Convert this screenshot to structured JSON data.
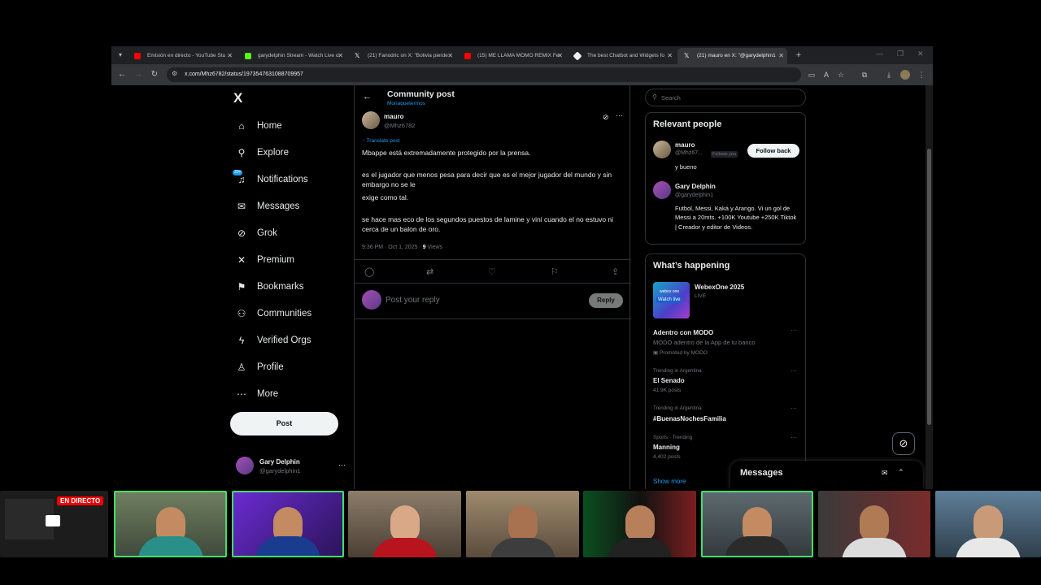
{
  "browser": {
    "tabs": [
      {
        "label": "Emisión en directo - YouTube Stu",
        "fav": "#ff0000"
      },
      {
        "label": "garydelphin Stream - Watch Live o",
        "fav": "#53fc18"
      },
      {
        "label": "(21) Fanodric on X: \"Bolivia pierde",
        "fav": "#000000"
      },
      {
        "label": "(15) ME LLAMA MOMO REMIX Fe",
        "fav": "#ff0000"
      },
      {
        "label": "The best Chatbot and Widgets fo",
        "fav": "#eeeeee"
      },
      {
        "label": "(21) mauro en X: \"@garydelphin1",
        "fav": "#000000"
      }
    ],
    "url": "x.com/Mhz6782/status/1973547631088709957"
  },
  "nav": {
    "logo": "X",
    "items": [
      {
        "label": "Home",
        "icon": "⌂"
      },
      {
        "label": "Explore",
        "icon": "⚲"
      },
      {
        "label": "Notifications",
        "icon": "♫"
      },
      {
        "label": "Messages",
        "icon": "✉"
      },
      {
        "label": "Grok",
        "icon": "⊘"
      },
      {
        "label": "Premium",
        "icon": "✕"
      },
      {
        "label": "Bookmarks",
        "icon": "⚑"
      },
      {
        "label": "Communities",
        "icon": "⚇"
      },
      {
        "label": "Verified Orgs",
        "icon": "ϟ"
      },
      {
        "label": "Profile",
        "icon": "♙"
      },
      {
        "label": "More",
        "icon": "⋯"
      }
    ],
    "notif_badge": "20+",
    "post_label": "Post",
    "me_name": "Gary Delphin",
    "me_handle": "@garydelphin1"
  },
  "post": {
    "header_title": "Community post",
    "header_sub": "Monaquetermos",
    "author_name": "mauro",
    "author_handle": "@Mhz6782",
    "translate": "Translate post",
    "paragraphs": [
      "Mbappe está extremadamente protegido por la prensa.",
      "es el jugador que menos pesa para decir que es el mejor jugador del mundo y sin embargo no se le",
      "exige como tal.",
      "se hace mas eco de los segundos puestos de lamine y vini cuando el no estuvo ni cerca de un balon de oro."
    ],
    "time": "9:36 PM · Oct 1, 2025 · ",
    "views_count": "9",
    "views_label": " Views",
    "reply_placeholder": "Post your reply",
    "reply_button": "Reply"
  },
  "right": {
    "search_placeholder": "Search",
    "relevant_title": "Relevant people",
    "people": [
      {
        "name": "mauro",
        "handle": "@Mhz67...",
        "tag": "Follows you",
        "bio": "y bueno",
        "follow": "Follow back"
      },
      {
        "name": "Gary Delphin",
        "handle": "@garydelphin1",
        "bio": "Futbol, Messi, Kaká y Arango. Vi un gol de Messi a 20mts. +100K Youtube +250K Tiktok | Creador y editor de Videos."
      }
    ],
    "happening_title": "What’s happening",
    "event": {
      "name": "WebexOne 2025",
      "status": "LIVE",
      "thumb_top": "webex one",
      "thumb_btn": "Watch live"
    },
    "trends": [
      {
        "context": "",
        "name": "Adentro con MODO",
        "sub": "MODO adentro de la App de tu banco",
        "count": "Promoted by MODO"
      },
      {
        "context": "Trending in Argentina",
        "name": "El Senado",
        "count": "41.9K posts"
      },
      {
        "context": "Trending in Argentina",
        "name": "#BuenasNochesFamilia",
        "count": ""
      },
      {
        "context": "Sports · Trending",
        "name": "Manning",
        "count": "4,402 posts"
      }
    ],
    "show_more": "Show more",
    "messages_title": "Messages"
  },
  "stream": {
    "live_label": "EN DIRECTO"
  }
}
